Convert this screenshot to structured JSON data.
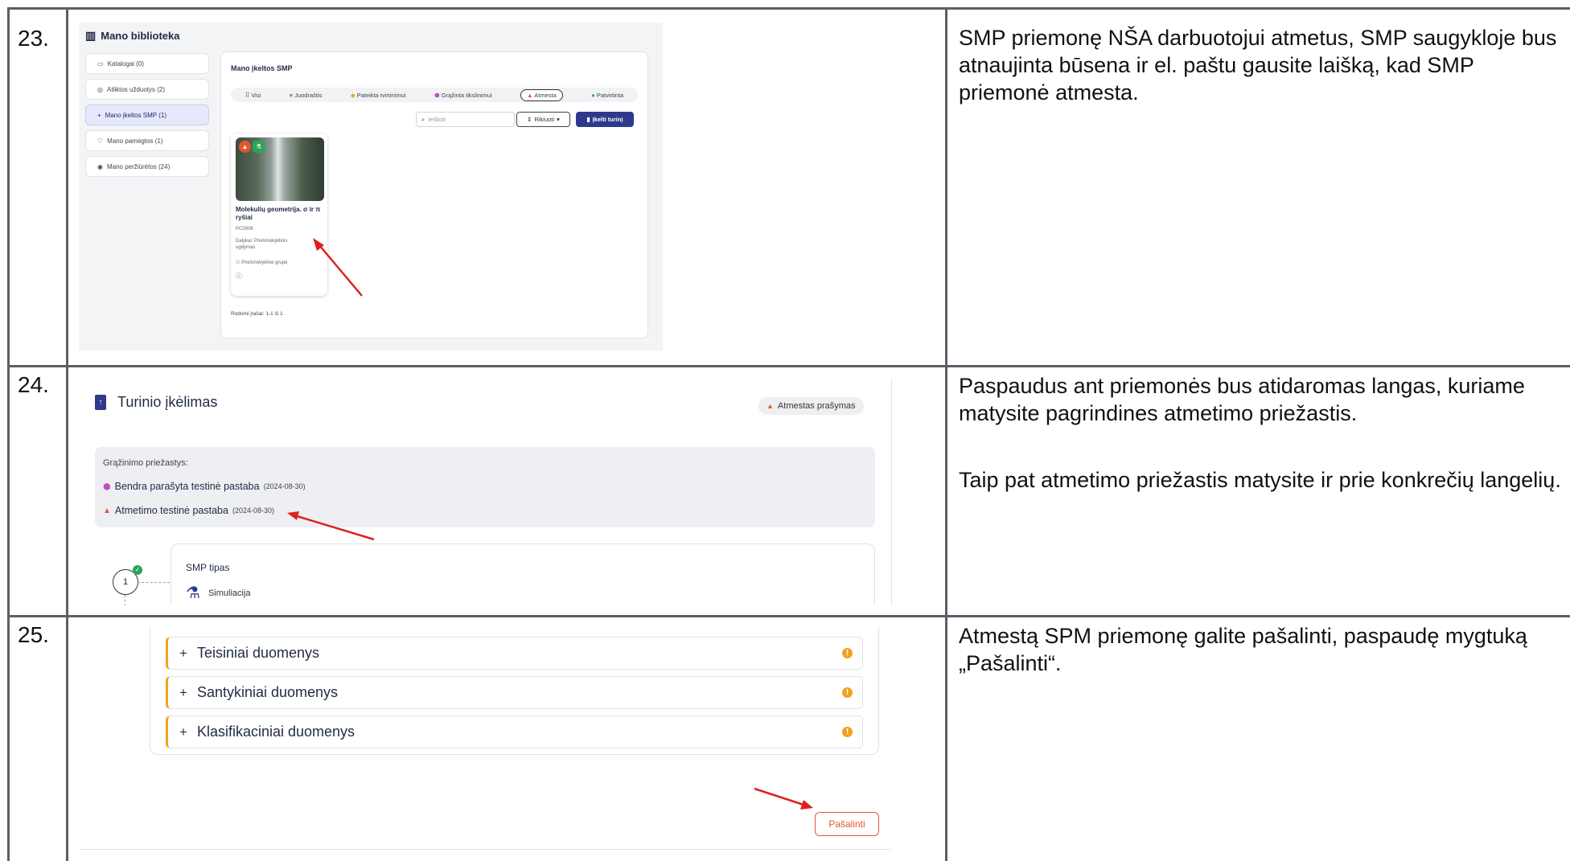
{
  "rows": [
    {
      "number": "23.",
      "description": "SMP priemonę NŠA darbuotojui atmetus, SMP saugykloje bus atnaujinta būsena ir el. paštu gausite laišką, kad SMP priemonė atmesta.",
      "library": {
        "title": "Mano biblioteka",
        "sidebar": [
          {
            "label": "Katalogai (0)",
            "icon": "folder-icon"
          },
          {
            "label": "Atliktos užduotys (2)",
            "icon": "check-circle-icon"
          },
          {
            "label": "Mano įkeltos SMP (1)",
            "icon": "plus-icon"
          },
          {
            "label": "Mano pamėgtos (1)",
            "icon": "heart-icon"
          },
          {
            "label": "Mano peržiūrėtos (24)",
            "icon": "eye-icon"
          }
        ],
        "panel_title": "Mano įkeltos SMP",
        "filters": [
          "Visi",
          "Juodraštis",
          "Pateikta tvirtinimui",
          "Grąžinta tikslinimui",
          "Atmesta",
          "Patvirtinta"
        ],
        "search_placeholder": "Ieškoti",
        "sort_label": "Rikiuoti",
        "upload_label": "Įkelti turinį",
        "card": {
          "title": "Molekulių geometrija. σ ir π ryšiai",
          "code": "PC0006",
          "subjects": "Dalykai: Priešmokyklinis ugdymas",
          "group": "Priešmokyklinė grupė"
        },
        "shown": "Rodomi įrašai: 1-1 iš 1"
      }
    },
    {
      "number": "24.",
      "description_1": "Paspaudus ant priemonės bus atidaromas langas, kuriame matysite pagrindines atmetimo priežastis.",
      "description_2": "Taip pat atmetimo priežastis matysite ir prie konkrečių langelių.",
      "upload": {
        "title": "Turinio įkėlimas",
        "status_badge": "Atmestas prašymas",
        "reasons_title": "Grąžinimo priežastys:",
        "reasons": [
          {
            "text": "Bendra parašyta testinė pastaba",
            "date": "(2024-08-30)"
          },
          {
            "text": "Atmetimo testinė pastaba",
            "date": "(2024-08-30)"
          }
        ],
        "step_number": "1",
        "section_title": "SMP tipas",
        "type_label": "Simuliacija"
      }
    },
    {
      "number": "25.",
      "description": "Atmestą SPM priemonę galite pašalinti, paspaudę mygtuką „Pašalinti“.",
      "sections": [
        {
          "label": "Teisiniai duomenys"
        },
        {
          "label": "Santykiniai duomenys"
        },
        {
          "label": "Klasifikaciniai duomenys"
        }
      ],
      "remove_label": "Pašalinti"
    }
  ],
  "colors": {
    "accent": "#2d3a8c",
    "reject": "#e4572e",
    "pink": "#c04fc0",
    "green": "#2aa55a",
    "warning": "#f0a21f",
    "arrow": "#e02020"
  }
}
